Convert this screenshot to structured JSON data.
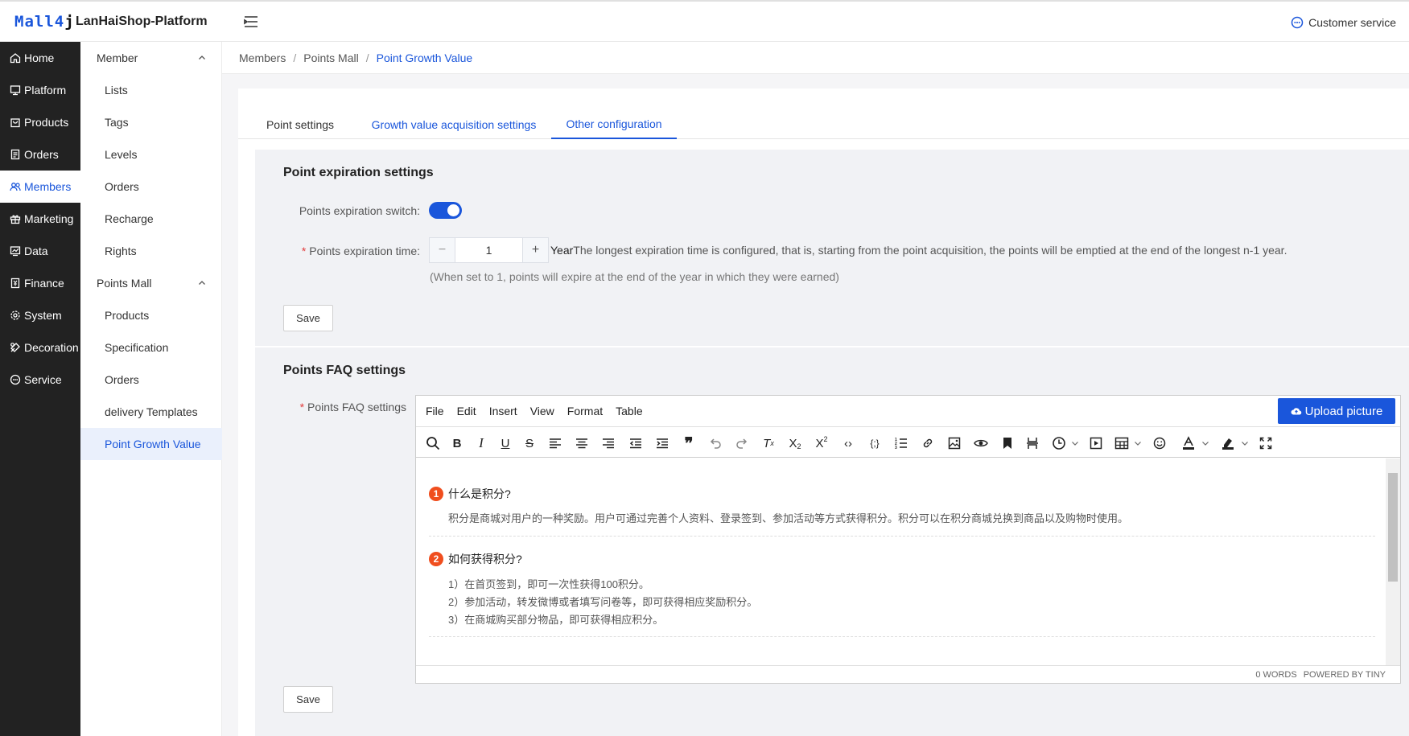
{
  "header": {
    "logo_main": "Mall4",
    "logo_accent": "j",
    "platform_name": "LanHaiShop-Platform",
    "customer_service": "Customer service"
  },
  "nav": [
    {
      "label": "Home",
      "icon": "home-icon"
    },
    {
      "label": "Platform",
      "icon": "monitor-icon"
    },
    {
      "label": "Products",
      "icon": "bag-icon"
    },
    {
      "label": "Orders",
      "icon": "document-icon"
    },
    {
      "label": "Members",
      "icon": "users-icon",
      "active": true
    },
    {
      "label": "Marketing",
      "icon": "gift-icon"
    },
    {
      "label": "Data",
      "icon": "chart-icon"
    },
    {
      "label": "Finance",
      "icon": "finance-icon"
    },
    {
      "label": "System",
      "icon": "gear-icon"
    },
    {
      "label": "Decoration",
      "icon": "palette-icon"
    },
    {
      "label": "Service",
      "icon": "chat-icon"
    }
  ],
  "subnav": {
    "member_group": "Member",
    "member_items": [
      "Lists",
      "Tags",
      "Levels",
      "Orders",
      "Recharge",
      "Rights"
    ],
    "points_group": "Points Mall",
    "points_items": [
      "Products",
      "Specification",
      "Orders",
      "delivery Templates",
      "Point Growth Value"
    ]
  },
  "breadcrumb": [
    "Members",
    "Points Mall",
    "Point Growth Value"
  ],
  "tabs": [
    "Point settings",
    "Growth value acquisition settings",
    "Other configuration"
  ],
  "expiration": {
    "title": "Point expiration settings",
    "switch_label": "Points expiration switch:",
    "switch_on": true,
    "time_label": "Points expiration time:",
    "time_value": "1",
    "unit": "Year",
    "unit_note": "The longest expiration time is configured, that is, starting from the point acquisition, the points will be emptied at the end of the longest n-1 year.",
    "hint": "(When set to 1, points will expire at the end of the year in which they were earned)",
    "save": "Save"
  },
  "faq": {
    "title": "Points FAQ settings",
    "label": "Points FAQ settings",
    "menubar": [
      "File",
      "Edit",
      "Insert",
      "View",
      "Format",
      "Table"
    ],
    "upload": "Upload picture",
    "q1_num": "1",
    "q1": "什么是积分?",
    "a1": "积分是商城对用户的一种奖励。用户可通过完善个人资料、登录签到、参加活动等方式获得积分。积分可以在积分商城兑换到商品以及购物时使用。",
    "q2_num": "2",
    "q2": "如何获得积分?",
    "a2_1": "1）在首页签到，即可一次性获得100积分。",
    "a2_2": "2）参加活动，转发微博或者填写问卷等，即可获得相应奖励积分。",
    "a2_3": "3）在商城购买部分物品，即可获得相应积分。",
    "status_words": "0 WORDS",
    "status_powered": "POWERED BY TINY",
    "save": "Save"
  },
  "colors": {
    "accent": "#1a56db",
    "sidebar_dark": "#222222",
    "badge": "#f04e1e"
  }
}
